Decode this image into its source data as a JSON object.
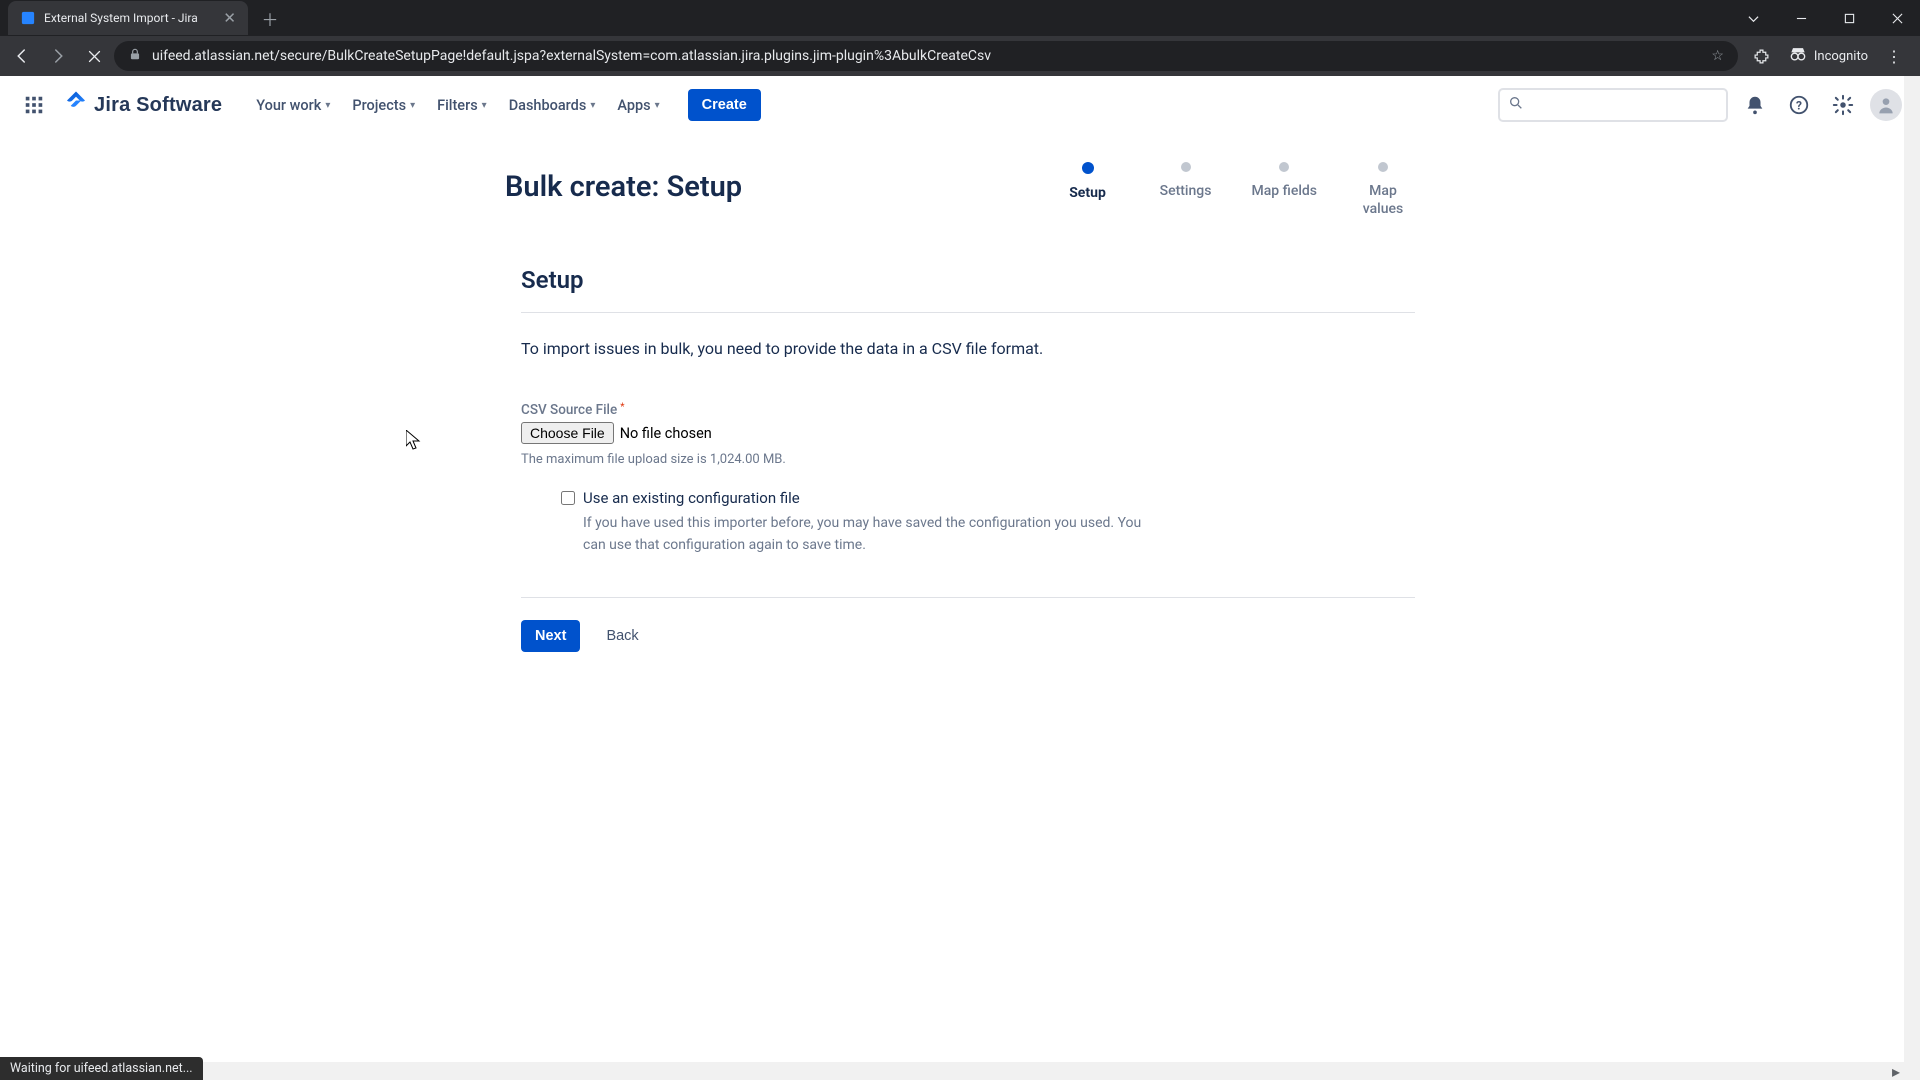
{
  "browser": {
    "tab_title": "External System Import - Jira",
    "url": "uifeed.atlassian.net/secure/BulkCreateSetupPage!default.jspa?externalSystem=com.atlassian.jira.plugins.jim-plugin%3AbulkCreateCsv",
    "incognito_label": "Incognito",
    "status_text": "Waiting for uifeed.atlassian.net..."
  },
  "header": {
    "product": "Jira Software",
    "nav": {
      "your_work": "Your work",
      "projects": "Projects",
      "filters": "Filters",
      "dashboards": "Dashboards",
      "apps": "Apps"
    },
    "create": "Create"
  },
  "page": {
    "title": "Bulk create: Setup",
    "steps": [
      {
        "label": "Setup",
        "active": true
      },
      {
        "label": "Settings",
        "active": false
      },
      {
        "label": "Map fields",
        "active": false
      },
      {
        "label": "Map values",
        "active": false
      }
    ],
    "section_title": "Setup",
    "intro": "To import issues in bulk, you need to provide the data in a CSV file format.",
    "file_field": {
      "label": "CSV Source File",
      "button": "Choose File",
      "status": "No file chosen",
      "hint": "The maximum file upload size is 1,024.00 MB."
    },
    "config_checkbox": {
      "label": "Use an existing configuration file",
      "hint": "If you have used this importer before, you may have saved the configuration you used. You can use that configuration again to save time."
    },
    "actions": {
      "next": "Next",
      "back": "Back"
    }
  }
}
